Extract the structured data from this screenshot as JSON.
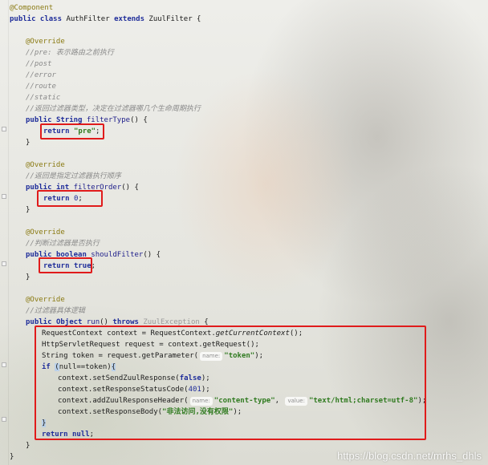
{
  "editor": {
    "lines": {
      "l1": [
        "@Component"
      ],
      "l2": [
        "public class ",
        "AuthFilter ",
        "extends ",
        "ZuulFilter {"
      ],
      "l4": [
        "@Override"
      ],
      "l5": [
        "//pre: 表示路由之前执行"
      ],
      "l6": [
        "//post"
      ],
      "l7": [
        "//error"
      ],
      "l8": [
        "//route"
      ],
      "l9": [
        "//static"
      ],
      "l10": [
        "//返回过滤器类型，决定在过滤器哪几个生命周期执行"
      ],
      "l11": [
        "public ",
        "String ",
        "filterType",
        "() {"
      ],
      "l12": [
        "return ",
        "\"pre\"",
        ";"
      ],
      "l13": [
        "}"
      ],
      "l15": [
        "@Override"
      ],
      "l16": [
        "//返回是指定过滤器执行顺序"
      ],
      "l17": [
        "public ",
        "int ",
        "filterOrder",
        "() {"
      ],
      "l18": [
        "return ",
        "0",
        ";"
      ],
      "l19": [
        "}"
      ],
      "l21": [
        "@Override"
      ],
      "l22": [
        "//判断过滤器是否执行"
      ],
      "l23": [
        "public ",
        "boolean ",
        "shouldFilter",
        "() {"
      ],
      "l24": [
        "return ",
        "true",
        ";"
      ],
      "l25": [
        "}"
      ],
      "l27": [
        "@Override"
      ],
      "l28": [
        "//过滤器具体逻辑"
      ],
      "l29": [
        "public ",
        "Object ",
        "run",
        "() ",
        "throws ",
        "ZuulException",
        " {"
      ],
      "l30": [
        "RequestContext context = RequestContext.",
        "getCurrentContext",
        "();"
      ],
      "l31": [
        "HttpServletRequest request = context.getRequest();"
      ],
      "l32": [
        "String token = request.getParameter(",
        "name:",
        "\"token\"",
        ");"
      ],
      "l33": [
        "if ",
        "(",
        "null==token",
        ")",
        "{"
      ],
      "l34": [
        "context.setSendZuulResponse(",
        "false",
        ");"
      ],
      "l35": [
        "context.setResponseStatusCode(",
        "401",
        ");"
      ],
      "l36": [
        "context.addZuulResponseHeader(",
        "name:",
        "\"content-type\"",
        ", ",
        "value:",
        "\"text/html;charset=utf-8\"",
        ");"
      ],
      "l37": [
        "context.setResponseBody(",
        "\"非法访问,没有权限\"",
        ");"
      ],
      "l38": [
        "}"
      ],
      "l39": [
        "return ",
        "null",
        ";"
      ],
      "l40": [
        "}"
      ],
      "l41": [
        "}"
      ]
    }
  },
  "watermark": "https://blog.csdn.net/mrhs_dhls",
  "colors": {
    "highlight_box": "#e01b1b",
    "keyword": "#1f2d9a",
    "annotation": "#8a7a12",
    "comment": "#8a8a8a",
    "string": "#2f7a1f"
  }
}
